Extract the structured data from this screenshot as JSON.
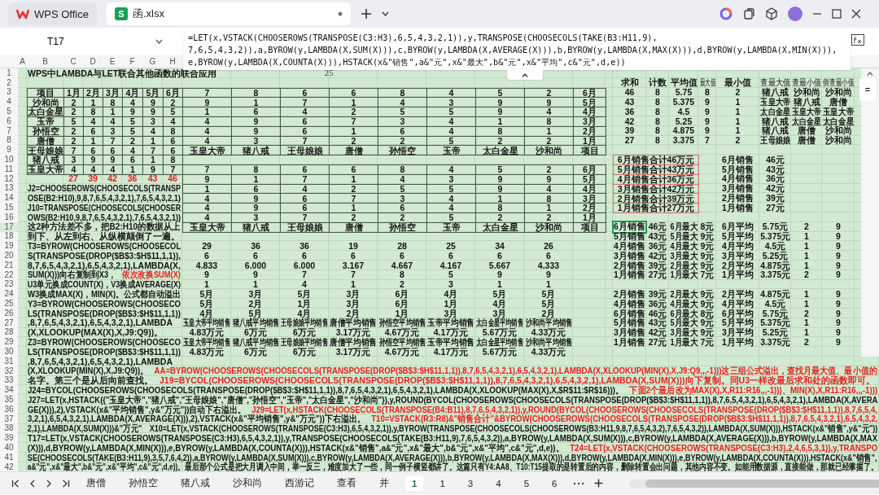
{
  "window": {
    "tabs": [
      {
        "label": "WPS Office",
        "kind": "home",
        "selected": false
      },
      {
        "label": "函.xlsx",
        "kind": "file",
        "icon_text": "S",
        "selected": true
      }
    ]
  },
  "name_box": "T17",
  "formula": "=LET(x,VSTACK(CHOOSEROWS(TRANSPOSE(C3:H3),6,5,4,3,2,1)),y,TRANSPOSE(CHOOSECOLS(TAKE(B3:H11,9),\n7,6,5,4,3,2)),a,BYROW(y,LAMBDA(X,SUM(X))),c,BYROW(y,LAMBDA(X,AVERAGE(X))),b,BYROW(y,LAMBDA(X,MAX(X))),d,BYROW(y,LAMBDA(X,MIN(X))),\ne,BYROW(y,LAMBDA(X,COUNTA(X))),HSTACK(x&\"销售\",a&\"元\",x&\"最大\",b&\"元\",x&\"平均\",c&\"元\",d,e))",
  "column_headers": [
    "A",
    "B",
    "C",
    "D",
    "E",
    "F",
    "G",
    "H"
  ],
  "side_fragment": "=",
  "rows": [
    {
      "number": "1",
      "left": {
        "kind": "title",
        "texts": [
          "WPS中LAMBDA与LET联合其他函数的联合应用"
        ]
      },
      "middle": {
        "kind": "serif",
        "texts": [
          "25"
        ]
      }
    },
    {
      "number": "2",
      "right": {
        "kind": "header",
        "texts": [
          "求和",
          "计数",
          "平均值",
          "最大值",
          "最小值",
          "查最大值",
          "查最小值",
          "倒查最小值"
        ]
      }
    },
    {
      "number": "3",
      "left": {
        "kind": "table",
        "texts": [
          "项目",
          "1月",
          "2月",
          "3月",
          "4月",
          "5月",
          "6月"
        ]
      },
      "middle": {
        "kind": "table",
        "texts": [
          "7",
          "8",
          "6",
          "6",
          "8",
          "4",
          "5",
          "2",
          "6月"
        ]
      },
      "right": {
        "kind": "value",
        "texts": [
          "46",
          "8",
          "5.75",
          "8",
          "2",
          "猪八戒",
          "沙和尚",
          "沙和尚"
        ]
      }
    },
    {
      "number": "4",
      "left": {
        "kind": "table",
        "texts": [
          "沙和尚",
          "2",
          "1",
          "8",
          "4",
          "9",
          "2"
        ]
      },
      "middle": {
        "kind": "table",
        "texts": [
          "9",
          "1",
          "7",
          "1",
          "4",
          "3",
          "9",
          "9",
          "5月"
        ]
      },
      "right": {
        "kind": "value",
        "texts": [
          "43",
          "8",
          "5.375",
          "9",
          "1",
          "玉皇大帝",
          "猪八戒",
          "唐僧"
        ]
      }
    },
    {
      "number": "5",
      "left": {
        "kind": "table",
        "texts": [
          "太白金星",
          "2",
          "8",
          "1",
          "9",
          "9",
          "5"
        ]
      },
      "middle": {
        "kind": "table",
        "texts": [
          "1",
          "6",
          "4",
          "2",
          "5",
          "5",
          "9",
          "4",
          "4月"
        ]
      },
      "right": {
        "kind": "value",
        "texts": [
          "36",
          "8",
          "4.5",
          "9",
          "1",
          "太白金星",
          "玉皇大帝",
          "玉皇大帝"
        ]
      }
    },
    {
      "number": "6",
      "left": {
        "kind": "table",
        "texts": [
          "玉帝",
          "5",
          "4",
          "4",
          "5",
          "3",
          "4"
        ]
      },
      "middle": {
        "kind": "table",
        "texts": [
          "4",
          "9",
          "6",
          "7",
          "3",
          "4",
          "1",
          "8",
          "3月"
        ]
      },
      "right": {
        "kind": "value",
        "texts": [
          "42",
          "8",
          "5.25",
          "9",
          "1",
          "猪八戒",
          "太白金星",
          "太白金星"
        ]
      }
    },
    {
      "number": "7",
      "left": {
        "kind": "table",
        "texts": [
          "孙悟空",
          "2",
          "6",
          "3",
          "5",
          "4",
          "8"
        ]
      },
      "middle": {
        "kind": "table",
        "texts": [
          "4",
          "9",
          "6",
          "1",
          "6",
          "4",
          "8",
          "1",
          "2月"
        ]
      },
      "right": {
        "kind": "value",
        "texts": [
          "39",
          "8",
          "4.875",
          "9",
          "1",
          "猪八戒",
          "唐僧",
          "沙和尚"
        ]
      }
    },
    {
      "number": "8",
      "left": {
        "kind": "table",
        "texts": [
          "唐僧",
          "2",
          "1",
          "7",
          "2",
          "1",
          "6"
        ]
      },
      "middle": {
        "kind": "table",
        "texts": [
          "4",
          "3",
          "7",
          "2",
          "2",
          "5",
          "2",
          "2",
          "1月"
        ]
      },
      "right": {
        "kind": "value",
        "texts": [
          "27",
          "8",
          "3.375",
          "7",
          "2",
          "王母娘娘",
          "唐僧",
          "沙和尚"
        ]
      }
    },
    {
      "number": "9",
      "left": {
        "kind": "table",
        "texts": [
          "王母娘娘",
          "7",
          "6",
          "6",
          "4",
          "7",
          "6"
        ]
      },
      "middle": {
        "kind": "table",
        "texts": [
          "玉皇大帝",
          "猪八戒",
          "王母娘娘",
          "唐僧",
          "孙悟空",
          "玉帝",
          "太白金星",
          "沙和尚",
          "项目"
        ]
      }
    },
    {
      "number": "10",
      "left": {
        "kind": "table",
        "texts": [
          "猪八戒",
          "3",
          "9",
          "9",
          "6",
          "1",
          "8"
        ]
      },
      "right": {
        "kind": "summary",
        "texts": [
          "6月销售合计46万元",
          "6月销售",
          "46元"
        ]
      }
    },
    {
      "number": "11",
      "left": {
        "kind": "table",
        "texts": [
          "玉皇大帝",
          "4",
          "4",
          "4",
          "1",
          "9",
          "7"
        ]
      },
      "middle": {
        "kind": "table",
        "texts": [
          "7",
          "8",
          "6",
          "6",
          "8",
          "4",
          "5",
          "2",
          "6月"
        ]
      },
      "right": {
        "kind": "summary",
        "texts": [
          "5月销售合计43万元",
          "5月销售",
          "43元"
        ]
      }
    },
    {
      "number": "12",
      "left": {
        "kind": "total",
        "texts": [
          "27",
          "39",
          "42",
          "36",
          "43",
          "46"
        ]
      },
      "middle": {
        "kind": "table",
        "texts": [
          "9",
          "1",
          "7",
          "1",
          "4",
          "3",
          "9",
          "9",
          "5月"
        ]
      },
      "right": {
        "kind": "summary",
        "texts": [
          "4月销售合计36万元",
          "4月销售",
          "36元"
        ]
      }
    },
    {
      "number": "13",
      "left": {
        "kind": "note",
        "texts": [
          "J2=CHOOSEROWS(CHOOSECOLS(TRANSP"
        ]
      },
      "middle": {
        "kind": "table",
        "texts": [
          "1",
          "6",
          "4",
          "2",
          "5",
          "5",
          "9",
          "4",
          "4月"
        ]
      },
      "right": {
        "kind": "summary",
        "texts": [
          "3月销售合计42万元",
          "3月销售",
          "42元"
        ]
      }
    },
    {
      "number": "14",
      "left": {
        "kind": "note",
        "texts": [
          "OSE(B2:H10),9,8,7,6,5,4,3,2,1),7,6,5,4,3,2,1)"
        ]
      },
      "middle": {
        "kind": "table",
        "texts": [
          "4",
          "9",
          "6",
          "7",
          "3",
          "4",
          "1",
          "8",
          "3月"
        ]
      },
      "right": {
        "kind": "summary",
        "texts": [
          "2月销售合计39万元",
          "2月销售",
          "39元"
        ]
      }
    },
    {
      "number": "15",
      "left": {
        "kind": "note",
        "texts": [
          "J10=TRANSPOSE(CHOOSECOLS(CHOOSER"
        ]
      },
      "middle": {
        "kind": "table",
        "texts": [
          "4",
          "9",
          "6",
          "1",
          "6",
          "4",
          "8",
          "1",
          "2月"
        ]
      },
      "right": {
        "kind": "summary",
        "texts": [
          "1月销售合计27万元",
          "1月销售",
          "27元"
        ]
      }
    },
    {
      "number": "16",
      "left": {
        "kind": "note",
        "texts": [
          "OWS(B2:H10,9,8,7,6,5,4,3,2,1),7,6,5,4,3,2,1))"
        ]
      },
      "middle": {
        "kind": "table",
        "texts": [
          "4",
          "3",
          "7",
          "2",
          "2",
          "5",
          "2",
          "2",
          "1月"
        ]
      }
    },
    {
      "number": "17",
      "left": {
        "kind": "note",
        "texts": [
          "这2种方法差不多，把B2:H10的数据从上"
        ]
      },
      "middle": {
        "kind": "table",
        "texts": [
          "玉皇大帝",
          "猪八戒",
          "王母娘娘",
          "唐僧",
          "孙悟空",
          "玉帝",
          "太白金星",
          "沙和尚",
          "项目"
        ]
      },
      "right": {
        "kind": "value",
        "texts": [
          "6月销售",
          "46元",
          "6月最大",
          "8元",
          "6月平均",
          "5.75元",
          "2",
          "9"
        ]
      }
    },
    {
      "number": "18",
      "left": {
        "kind": "note",
        "texts": [
          "到下、从左到右、从纵横颠倒了一遍。"
        ]
      },
      "right": {
        "kind": "value",
        "texts": [
          "5月销售",
          "43元",
          "5月最大",
          "9元",
          "5月平均",
          "5.375元",
          "1",
          "9"
        ]
      }
    },
    {
      "number": "19",
      "left": {
        "kind": "note",
        "texts": [
          "T3=BYROW(CHOOSEROWS(CHOOSECOL"
        ]
      },
      "middle": {
        "kind": "value",
        "texts": [
          "29",
          "36",
          "36",
          "19",
          "28",
          "25",
          "34",
          "26"
        ]
      },
      "right": {
        "kind": "value",
        "texts": [
          "4月销售",
          "36元",
          "4月最大",
          "9元",
          "4月平均",
          "4.5元",
          "1",
          "9"
        ]
      }
    },
    {
      "number": "20",
      "left": {
        "kind": "note",
        "texts": [
          "S(TRANSPOSE(DROP($B$3:$H$11,1,1)),"
        ]
      },
      "middle": {
        "kind": "value",
        "texts": [
          "6",
          "6",
          "6",
          "6",
          "6",
          "6",
          "6",
          "6"
        ]
      },
      "right": {
        "kind": "value",
        "texts": [
          "3月销售",
          "42元",
          "3月最大",
          "9元",
          "3月平均",
          "5.25元",
          "1",
          "9"
        ]
      }
    },
    {
      "number": "21",
      "left": {
        "kind": "note",
        "texts": [
          "8,7,6,5,4,3,2,1),6,5,4,3,2,1),LAMBDA(X,"
        ]
      },
      "middle": {
        "kind": "value",
        "texts": [
          "4.833",
          "6.000",
          "6.000",
          "3.167",
          "4.667",
          "4.167",
          "5.667",
          "4.333"
        ]
      },
      "right": {
        "kind": "value",
        "texts": [
          "2月销售",
          "39元",
          "2月最大",
          "9元",
          "2月平均",
          "4.875元",
          "1",
          "9"
        ]
      }
    },
    {
      "number": "22",
      "left": {
        "kind": "mixed_note",
        "parts": [
          {
            "text": "SUM(X)))向右复制到X3，",
            "kind": "plain"
          },
          {
            "text": "依次改换SUM(X)",
            "kind": "red"
          }
        ]
      },
      "middle": {
        "kind": "value",
        "texts": [
          "9",
          "9",
          "7",
          "7",
          "8",
          "5",
          "9",
          "9"
        ]
      },
      "right": {
        "kind": "value",
        "texts": [
          "1月销售",
          "27元",
          "1月最大",
          "7元",
          "1月平均",
          "3.375元",
          "2",
          "9"
        ]
      }
    },
    {
      "number": "23",
      "left": {
        "kind": "note",
        "texts": [
          "U3单元换成COUNT(X)，V3换成AVERAGE(X)"
        ]
      },
      "middle": {
        "kind": "value",
        "texts": [
          "1",
          "1",
          "4",
          "1",
          "2",
          "3",
          "1",
          "1"
        ]
      }
    },
    {
      "number": "24",
      "left": {
        "kind": "note",
        "texts": [
          "W3换成MAX(X)，MIN(X)。公式都自动溢出"
        ]
      },
      "middle": {
        "kind": "value",
        "texts": [
          "5月",
          "3月",
          "5月",
          "3月",
          "6月",
          "4月",
          "5月",
          "5月"
        ]
      },
      "right": {
        "kind": "value",
        "texts": [
          "2月销售",
          "39元",
          "2月最大",
          "9元",
          "2月平均",
          "4.875元",
          "1",
          "9"
        ]
      }
    },
    {
      "number": "25",
      "left": {
        "kind": "note",
        "texts": [
          "Y3=BYROW(CHOOSEROWS(CHOOSECO"
        ]
      },
      "middle": {
        "kind": "value",
        "texts": [
          "5月",
          "2月",
          "1月",
          "3月",
          "6月",
          "1月",
          "4月",
          "5月"
        ]
      },
      "right": {
        "kind": "value",
        "texts": [
          "4月销售",
          "36元",
          "4月最大",
          "9元",
          "4月平均",
          "4.5元",
          "1",
          "9"
        ]
      }
    },
    {
      "number": "26",
      "left": {
        "kind": "note",
        "texts": [
          "LS(TRANSPOSE(DROP($B$3:$H$11,1,1))"
        ]
      },
      "middle": {
        "kind": "value",
        "texts": [
          "4月",
          "5月",
          "4月",
          "2月",
          "1月",
          "3月",
          "3月",
          "2月"
        ]
      },
      "right": {
        "kind": "value",
        "texts": [
          "6月销售",
          "46元",
          "6月最大",
          "8元",
          "6月平均",
          "5.75元",
          "2",
          "9"
        ]
      }
    },
    {
      "number": "27",
      "left": {
        "kind": "note",
        "texts": [
          ",8,7,6,5,4,3,2,1),6,5,4,3,2,1),LAMBDA"
        ]
      },
      "middle": {
        "kind": "value",
        "texts": [
          "玉皇大帝平均销售",
          "猪八戒平均销售",
          "王母娘娘平均销售",
          "唐僧平均销售",
          "孙悟空平均销售",
          "玉帝平均销售",
          "太白金星平均销售",
          "沙和尚平均销售"
        ]
      },
      "right": {
        "kind": "value",
        "texts": [
          "5月销售",
          "43元",
          "5月最大",
          "9元",
          "5月平均",
          "5.375元",
          "1",
          "9"
        ]
      }
    },
    {
      "number": "28",
      "left": {
        "kind": "note",
        "texts": [
          "(X,XLOOKUP(MAX(X),X,J9:Q9))。"
        ]
      },
      "middle": {
        "kind": "value",
        "texts": [
          "4.83万元",
          "6万元",
          "6万元",
          "3.17万元",
          "4.67万元",
          "4.17万元",
          "5.67万元",
          "4.33万元"
        ]
      },
      "right": {
        "kind": "value",
        "texts": [
          "3月销售",
          "42元",
          "3月最大",
          "9元",
          "3月平均",
          "5.25元",
          "1",
          "9"
        ]
      }
    },
    {
      "number": "29",
      "left": {
        "kind": "note",
        "texts": [
          "Z3=BYROW(CHOOSEROWS(CHOOSECO"
        ]
      },
      "middle": {
        "kind": "value",
        "texts": [
          "玉皇大帝平均销售",
          "猪八戒平均销售",
          "王母娘娘平均销售",
          "唐僧平均销售",
          "孙悟空平均销售",
          "玉帝平均销售",
          "太白金星平均销售",
          "沙和尚平均销售"
        ]
      },
      "right": {
        "kind": "value",
        "texts": [
          "1月销售",
          "27元",
          "1月最大",
          "7元",
          "1月平均",
          "3.375元",
          "2",
          "9"
        ]
      }
    },
    {
      "number": "30",
      "left": {
        "kind": "note",
        "texts": [
          "LS(TRANSPOSE(DROP($B$3:$H$11,1,1))"
        ]
      },
      "middle": {
        "kind": "value",
        "texts": [
          "4.83万元",
          "6万元",
          "6万元",
          "3.17万元",
          "4.67万元",
          "4.17万元",
          "5.67万元",
          "4.33万元"
        ]
      }
    },
    {
      "number": "31",
      "left": {
        "kind": "note",
        "texts": [
          ",8,7,6,5,4,3,2,1),6,5,4,3,2,1),LAMBDA"
        ]
      }
    },
    {
      "number": "32",
      "left": {
        "kind": "paragraph",
        "parts": [
          {
            "text": "(X,XLOOKUP(MIN(X),X,J9:Q9))。",
            "kind": "plain"
          },
          {
            "text": "AA=BYROW(CHOOSEROWS(CHOOSECOLS(TRANSPOSE(DROP($B$3:$H$11,1,1)),8,7,6,5,4,3,2,1),6,5,4,3,2,1),LAMBDA(X,XLOOKUP(MIN(X),X,J9:Q9,,,-1)))这三组公式溢出，查找月最大值、最小值的",
            "kind": "red"
          }
        ]
      }
    },
    {
      "number": "33",
      "left": {
        "kind": "paragraph",
        "parts": [
          {
            "text": "名字。第三个是从后向前查找。",
            "kind": "plain"
          },
          {
            "text": "J19=BYCOL(CHOOSEROWS(CHOOSECOLS(TRANSPOSE(DROP($B$3:$H$11,1,1)),8,7,6,5,4,3,2,1),6,5,4,3,2,1),LAMBDA(X,SUM(X)))向下复制。同U3一样改最后求和处的函数即可。",
            "kind": "red"
          }
        ]
      }
    },
    {
      "number": "34",
      "left": {
        "kind": "paragraph",
        "parts": [
          {
            "text": "J24=BYCOL(CHOOSEROWS(CHOOSECOLS(TRANSPOSE(DROP($B$3:$H$11,1,1)),8,7,6,5,4,3,2,1),6,5,4,3,2,1),LAMBDA(X,XLOOKUP(MAX(X),X,$R$11:$R$16)))。",
            "kind": "plain"
          },
          {
            "text": "下面2个最后改为MAX(X),X,R11:R16,,,-1)))、MIN(X),X,R11:R16,,,-1)))",
            "kind": "red"
          }
        ]
      }
    },
    {
      "number": "35",
      "left": {
        "kind": "paragraph",
        "parts": [
          {
            "text": "J27=LET(x,HSTACK({\"玉皇大帝\",\"猪八戒\",\"王母娘娘\",\"唐僧\",\"孙悟空\",\"玉帝\",\"太白金星\",\"沙和尚\"}),y,ROUND(BYCOL(CHOOSEROWS(CHOOSECOLS(TRANSPOSE(DROP($B$3:$H$11,1,1)),8,7,6,5,4,3,2,1),6,5,4,3,2,1),LAMBDA(X,AVERA",
            "kind": "plain"
          }
        ]
      }
    },
    {
      "number": "36",
      "left": {
        "kind": "paragraph",
        "parts": [
          {
            "text": "GE(X))),2),VSTACK(x&\"平均销售\",y&\"万元\"))自动下右溢出。",
            "kind": "plain"
          },
          {
            "text": "J29=LET(x,HSTACK(CHOOSECOLS(TRANSPOSE(B4:B11),8,7,6,5,4,3,2,1)),y,ROUND(BYCOL(CHOOSEROWS(CHOOSECOLS(TRANSPOSE(DROP($B$3:$H$11,1,1)),8,7,6,5,4,",
            "kind": "red"
          }
        ]
      }
    },
    {
      "number": "37",
      "left": {
        "kind": "paragraph",
        "parts": [
          {
            "text": "3,2,1),6,5,4,3,2,1),LAMBDA(X,AVERAGE(X))),2),VSTACK(x&\"平均销售\",y&\"万元\"))下右溢出。",
            "kind": "plain"
          },
          {
            "text": "T10=VSTACK(R3:R8)&\"销售合计\"&BYROW(CHOOSEROWS(CHOOSECOLS(TRANSPOSE(DROP($B$3:$H$11,1,1)),8,7,6,5,4,3,2,1),6,5,4,3,2,",
            "kind": "red"
          }
        ]
      }
    },
    {
      "number": "38",
      "left": {
        "kind": "paragraph",
        "parts": [
          {
            "text": "2,1),LAMBDA(X,SUM(X)))&\"万元\"　X10=LET(x,VSTACK(CHOOSEROWS(TRANSPOSE(C3:H3),6,5,4,3,2,1)),y,BYROW(TRANSPOSE(CHOOSECOLS(CHOOSEROWS(B3:H11,9,8,7,6,5,4,3,2),7,6,5,4,3,2)),LAMBDA(X,SUM(X))),HSTACK(x&\"销售\",y&\"元\"))",
            "kind": "plain"
          }
        ]
      }
    },
    {
      "number": "39",
      "left": {
        "kind": "paragraph",
        "parts": [
          {
            "text": "T17=LET(x,VSTACK(CHOOSEROWS(TRANSPOSE(C3:H3),6,5,4,3,2,1)),y,TRANSPOSE(CHOOSECOLS(TAKE(B3:H11,9),7,6,5,4,3,2)),a,BYROW(y,LAMBDA(X,SUM(X))),c,BYROW(y,LAMBDA(X,AVERAGE(X))),b,BYROW(y,LAMBDA(X,MAX",
            "kind": "plain"
          }
        ]
      }
    },
    {
      "number": "40",
      "left": {
        "kind": "paragraph",
        "parts": [
          {
            "text": "(X))),d,BYROW(y,LAMBDA(X,MIN(X))),e,BYROW(y,LAMBDA(X,COUNTA(X))),HSTACK(x&\"销售\",a&\"元\",x&\"最大\",b&\"元\",x&\"平均\",c&\"元\",d,e))。",
            "kind": "plain"
          },
          {
            "text": "T24=LET(x,VSTACK(CHOOSEROWS(TRANSPOSE(C3:H3),2,4,6,5,3,1)),y,TRANSPO",
            "kind": "red"
          }
        ]
      }
    },
    {
      "number": "41",
      "left": {
        "kind": "paragraph",
        "parts": [
          {
            "text": "SE(CHOOSECOLS(TAKE(B3:H11,9),3,5,7,6,4,2)),a,BYROW(y,LAMBDA(X,SUM(X))),c,BYROW(y,LAMBDA(X,AVERAGE(X))),b,BYROW(y,LAMBDA(X,MAX(X))),d,BYROW(y,LAMBDA(X,MIN(X))),e,BYROW(y,LAMBDA(X,COUNTA(X))),HSTACK(x&\"销售\",",
            "kind": "plain"
          }
        ]
      }
    },
    {
      "number": "42",
      "left": {
        "kind": "paragraph",
        "parts": [
          {
            "text": "a&\"元\",x&\"最大\",b&\"元\",x&\"平均\",c&\"元\",d,e))。最后那个公式是把大月调入中间，举一反三，难度加大了一些，同一例子横竖都讲了。这篇只有Y4:AA8、T10:T15提取的是转置后的内容，删除转置会出问题，其他内容不变。如能用数据源，直接能做，那就已经掌握了。",
            "kind": "plain"
          }
        ]
      }
    }
  ],
  "sheet_tabs": [
    {
      "label": "唐僧",
      "selected": false
    },
    {
      "label": "孙悟空",
      "selected": false
    },
    {
      "label": "猪八戒",
      "selected": false
    },
    {
      "label": "沙和尚",
      "selected": false
    },
    {
      "label": "西游记",
      "selected": false
    },
    {
      "label": "查看",
      "selected": false
    },
    {
      "label": "并",
      "selected": false
    },
    {
      "label": "1",
      "selected": true
    },
    {
      "label": "1",
      "selected": false
    },
    {
      "label": "3",
      "selected": false
    },
    {
      "label": "4",
      "selected": false
    },
    {
      "label": "5",
      "selected": false
    },
    {
      "label": "6",
      "selected": false
    }
  ]
}
